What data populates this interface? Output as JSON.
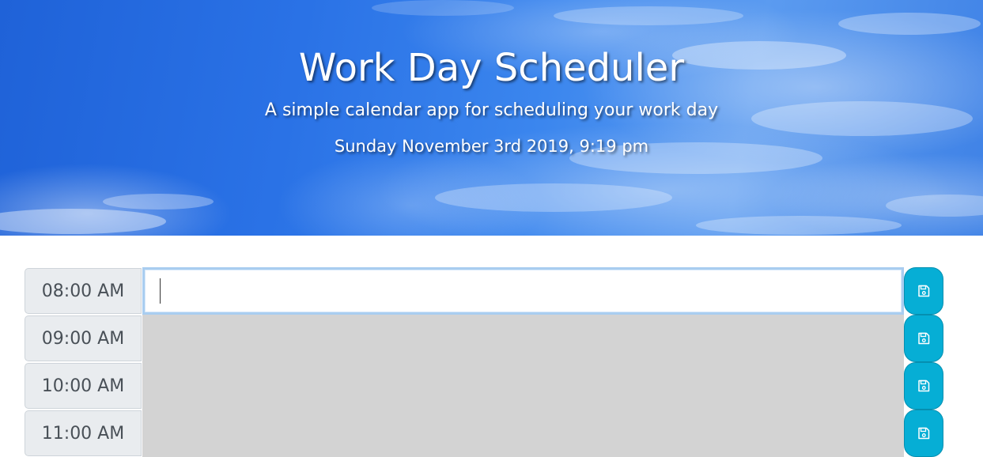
{
  "header": {
    "title": "Work Day Scheduler",
    "subtitle": "A simple calendar app for scheduling your work day",
    "current_date": "Sunday November 3rd 2019, 9:19 pm"
  },
  "scheduler": {
    "rows": [
      {
        "hour": "08:00 AM",
        "event": "",
        "state": "present"
      },
      {
        "hour": "09:00 AM",
        "event": "",
        "state": "past"
      },
      {
        "hour": "10:00 AM",
        "event": "",
        "state": "past"
      },
      {
        "hour": "11:00 AM",
        "event": "",
        "state": "past"
      }
    ],
    "save_icon": "floppy-disk-icon"
  },
  "colors": {
    "save_button": "#06aed5",
    "past_row": "#d3d3d3",
    "hour_label_bg": "#e9ecef",
    "focus_border": "#a9cdf0"
  }
}
